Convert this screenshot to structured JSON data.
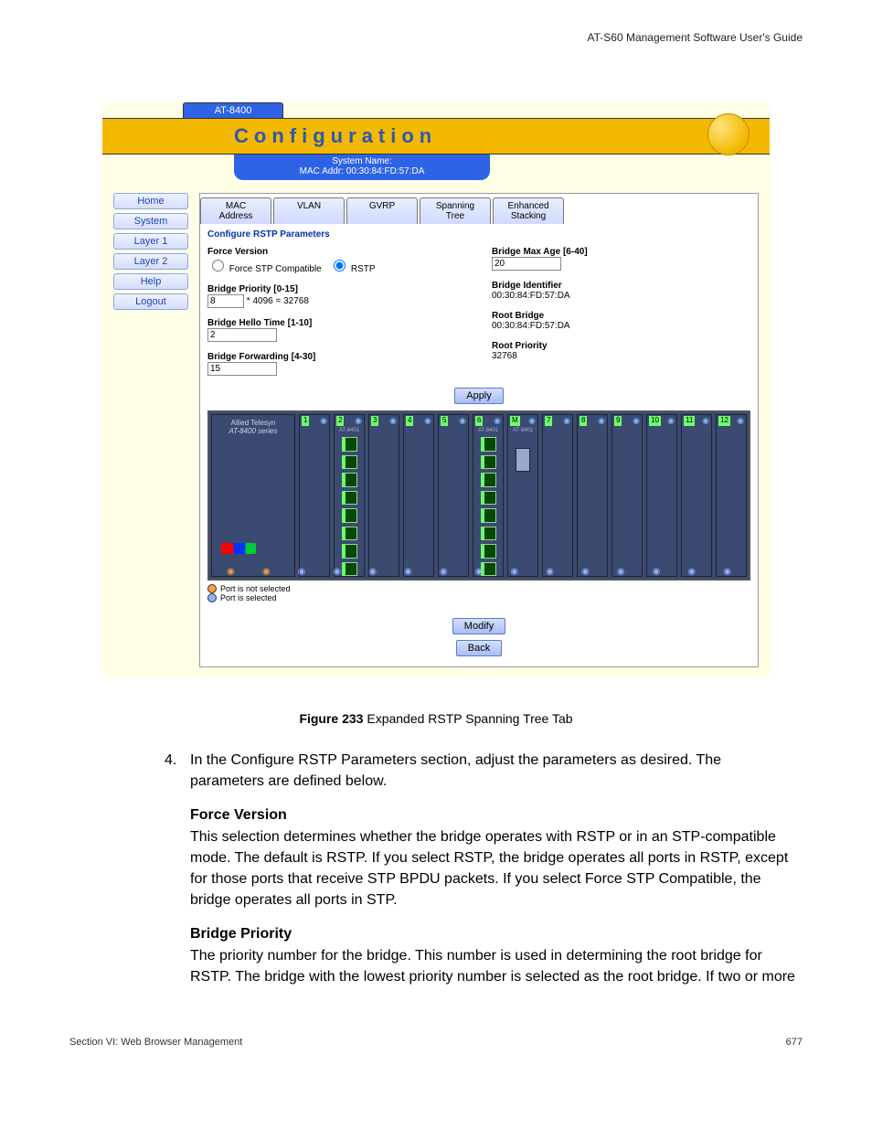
{
  "header": "AT-S60 Management Software User's Guide",
  "device_tab": "AT-8400",
  "config_title": "Configuration",
  "sysname": "System Name:\nMAC Addr: 00:30:84:FD:57:DA",
  "nav": [
    "Home",
    "System",
    "Layer 1",
    "Layer 2",
    "Help",
    "Logout"
  ],
  "tabs": [
    "MAC Address",
    "VLAN",
    "GVRP",
    "Spanning Tree",
    "Enhanced Stacking"
  ],
  "section_title": "Configure RSTP Parameters",
  "left_params": {
    "force_version_label": "Force Version",
    "force_stp_label": "Force STP Compatible",
    "rstp_label": "RSTP",
    "prio_label": "Bridge Priority [0-15]",
    "prio_value": "8",
    "prio_suffix": "* 4096 = 32768",
    "hello_label": "Bridge Hello Time [1-10]",
    "hello_value": "2",
    "fwd_label": "Bridge Forwarding [4-30]",
    "fwd_value": "15"
  },
  "right_params": {
    "maxage_label": "Bridge Max Age [6-40]",
    "maxage_value": "20",
    "bid_label": "Bridge Identifier",
    "bid_value": "00:30:84:FD:57:DA",
    "root_label": "Root Bridge",
    "root_value": "00:30:84:FD:57:DA",
    "rprio_label": "Root Priority",
    "rprio_value": "32768"
  },
  "apply": "Apply",
  "modify": "Modify",
  "back": "Back",
  "chassis_brand": "Allied Telesyn",
  "chassis_model": "AT-8400 series",
  "chassis_card": "AT-8401",
  "legend_unsel": "Port is not selected",
  "legend_sel": "Port is selected",
  "caption_bold": "Figure 233",
  "caption_rest": "  Expanded RSTP Spanning Tree Tab",
  "step_num": "4.",
  "step_text": "In the Configure RSTP Parameters section, adjust the parameters as desired. The parameters are defined below.",
  "fv_head": "Force Version",
  "fv_text": "This selection determines whether the bridge operates with RSTP or in an STP-compatible mode. The default is RSTP. If you select RSTP, the bridge operates all ports in RSTP, except for those ports that receive STP BPDU packets. If you select Force STP Compatible, the bridge operates all ports in STP.",
  "bp_head": "Bridge Priority",
  "bp_text": "The priority number for the bridge. This number is used in determining the root bridge for RSTP. The bridge with the lowest priority number is selected as the root bridge. If two or more",
  "footer_left": "Section VI: Web Browser Management",
  "footer_right": "677"
}
